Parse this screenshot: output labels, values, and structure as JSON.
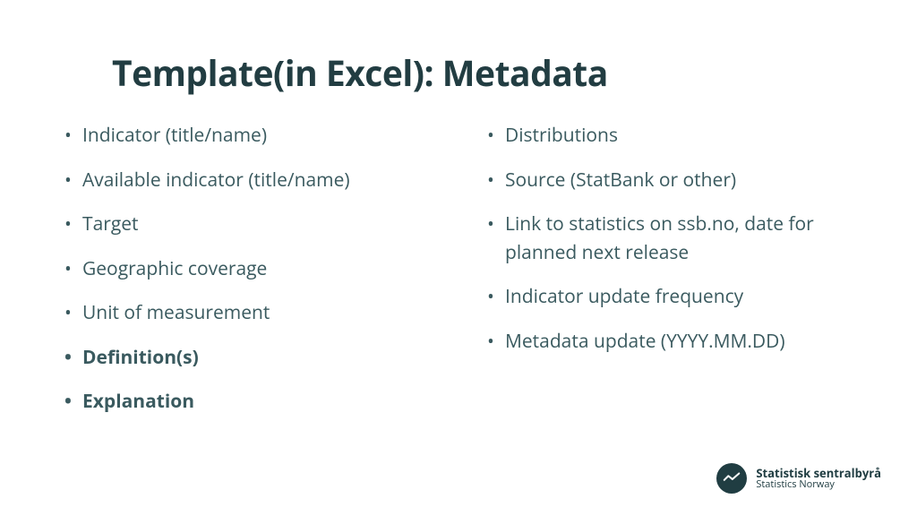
{
  "title": "Template(in Excel): Metadata",
  "left_items": [
    {
      "text": "Indicator (title/name)",
      "bold": false
    },
    {
      "text": "Available indicator (title/name)",
      "bold": false
    },
    {
      "text": "Target",
      "bold": false
    },
    {
      "text": "Geographic coverage",
      "bold": false
    },
    {
      "text": "Unit of measurement",
      "bold": false
    },
    {
      "text": "Definition(s)",
      "bold": true
    },
    {
      "text": "Explanation",
      "bold": true
    }
  ],
  "right_items": [
    {
      "text": "Distributions",
      "bold": false
    },
    {
      "text": "Source (StatBank or other)",
      "bold": false
    },
    {
      "text": "Link to statistics on ssb.no, date for planned next release",
      "bold": false
    },
    {
      "text": "Indicator update frequency",
      "bold": false
    },
    {
      "text": "Metadata update (YYYY.MM.DD)",
      "bold": false
    }
  ],
  "footer": {
    "primary": "Statistisk sentralbyrå",
    "secondary": "Statistics Norway"
  }
}
